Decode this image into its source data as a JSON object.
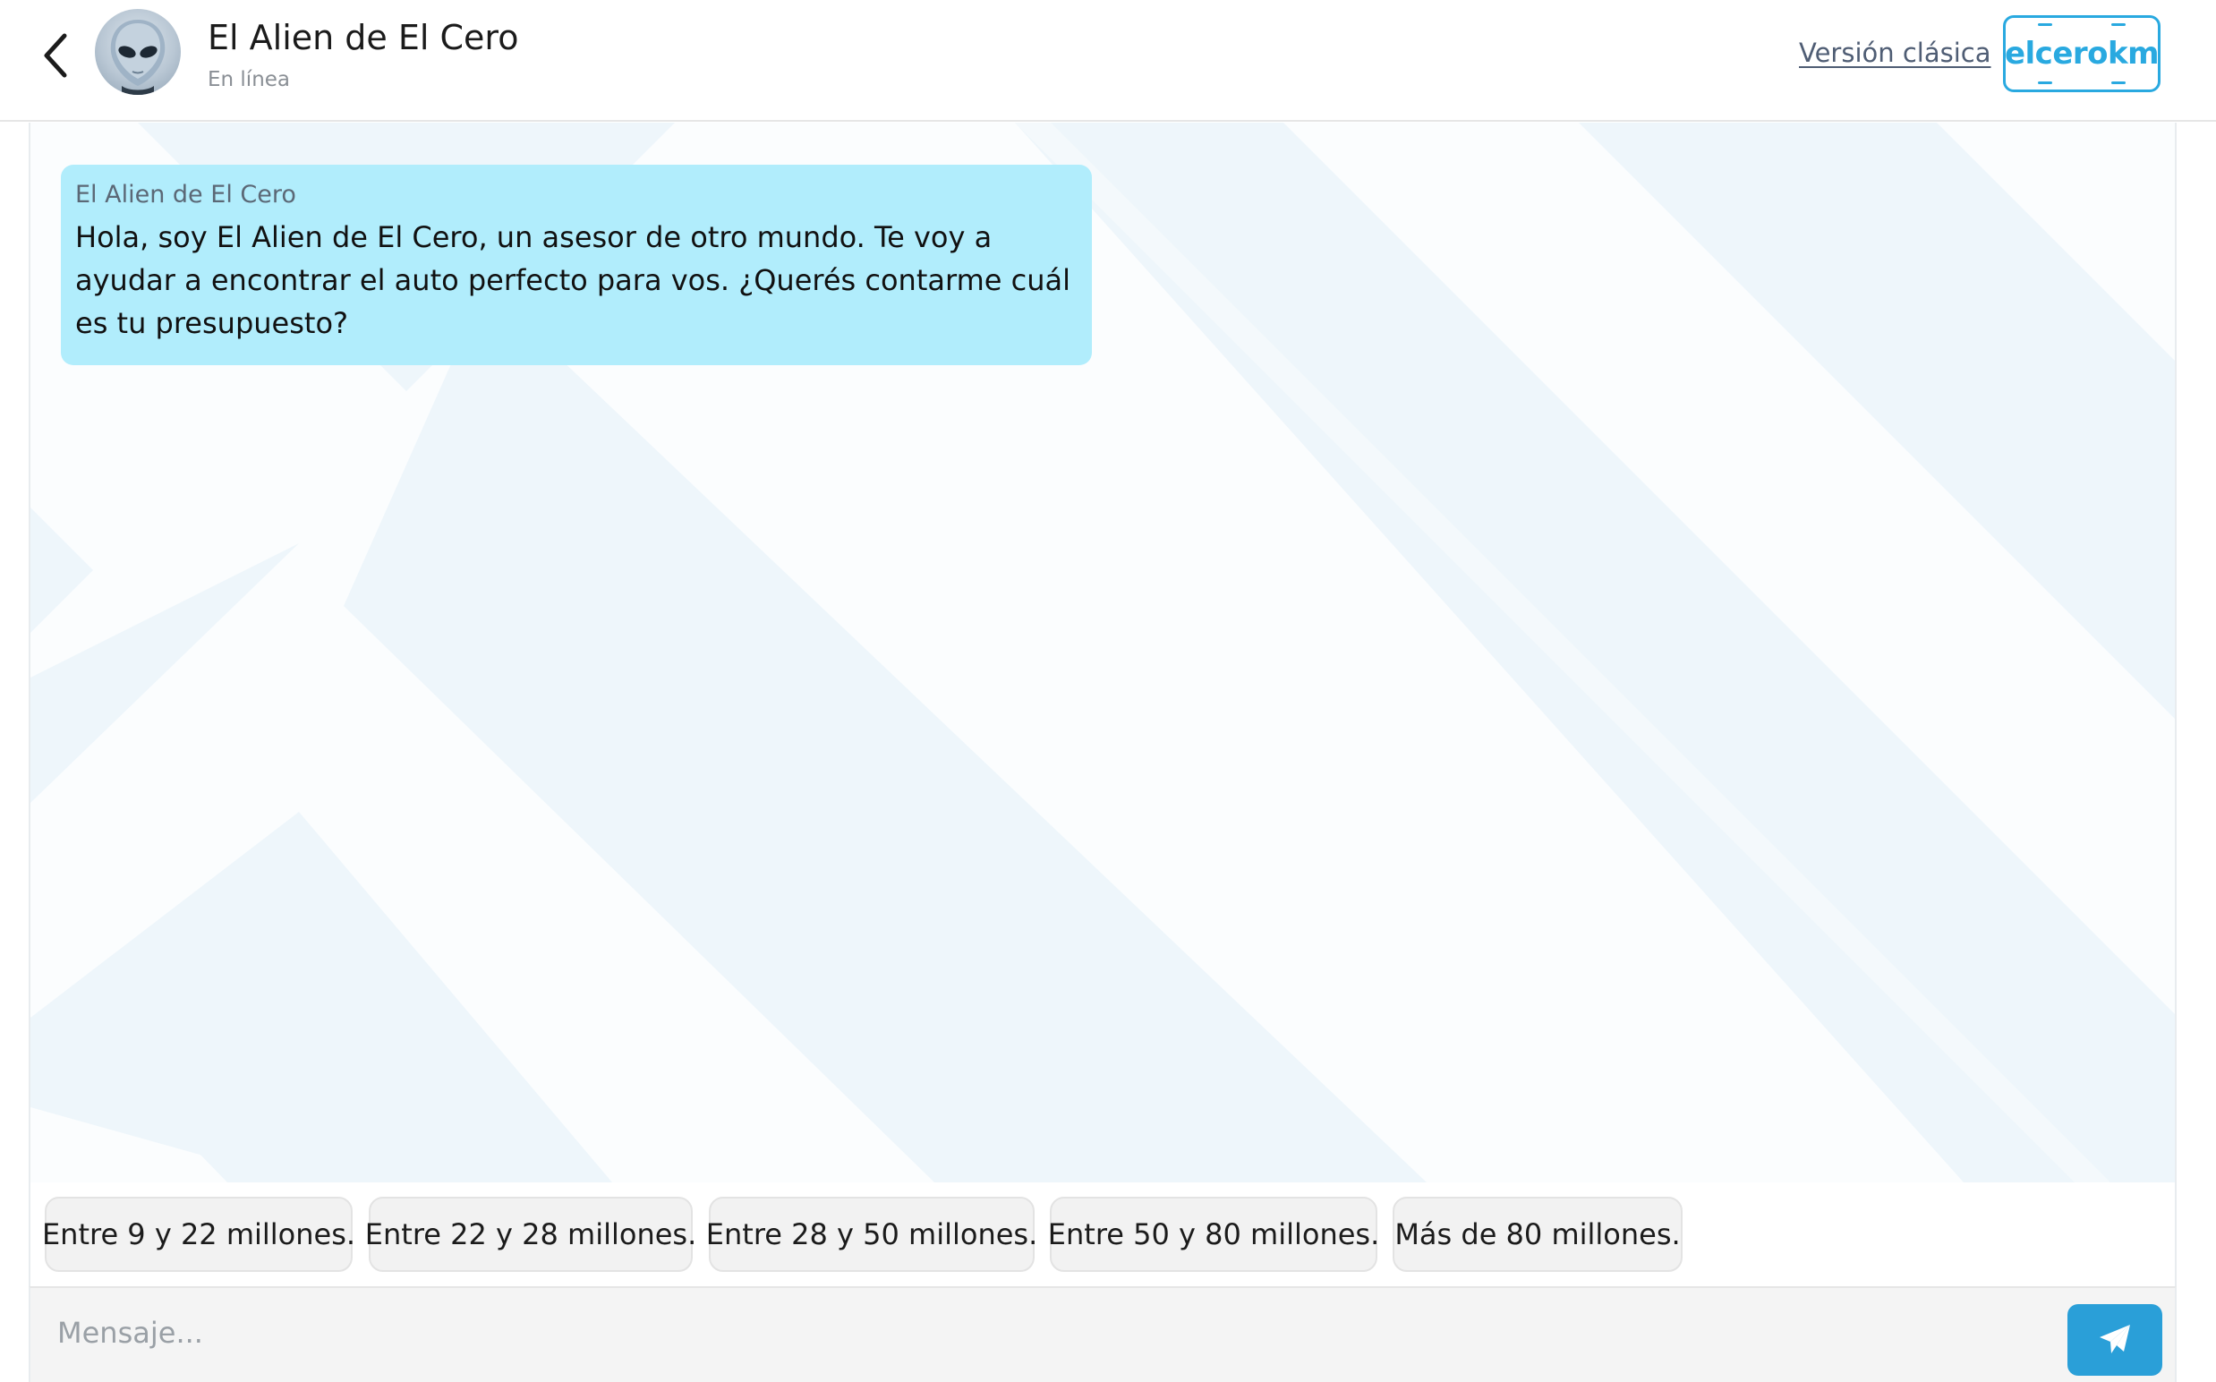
{
  "header": {
    "title": "El Alien de El Cero",
    "status": "En línea",
    "classic_link": "Versión clásica",
    "logo_text": "elcerokm",
    "back_icon": "chevron-left-icon",
    "avatar_icon": "alien-avatar"
  },
  "chat": {
    "messages": [
      {
        "sender": "El Alien de El Cero",
        "text": "Hola, soy El Alien de El Cero, un asesor de otro mundo. Te voy a ayudar a encontrar el auto perfecto para vos. ¿Querés contarme cuál es tu presupuesto?"
      }
    ]
  },
  "quick_replies": [
    "Entre 9 y 22 millones.",
    "Entre 22 y 28 millones.",
    "Entre 28 y 50 millones.",
    "Entre 50 y 80 millones.",
    "Más de 80 millones."
  ],
  "input": {
    "placeholder": "Mensaje...",
    "value": "",
    "send_icon": "paper-plane-icon"
  },
  "colors": {
    "accent": "#29a9e0",
    "bubble_bg": "#b1edfc",
    "send_button": "#2a9fd8",
    "chip_bg": "#f2f2f2"
  }
}
